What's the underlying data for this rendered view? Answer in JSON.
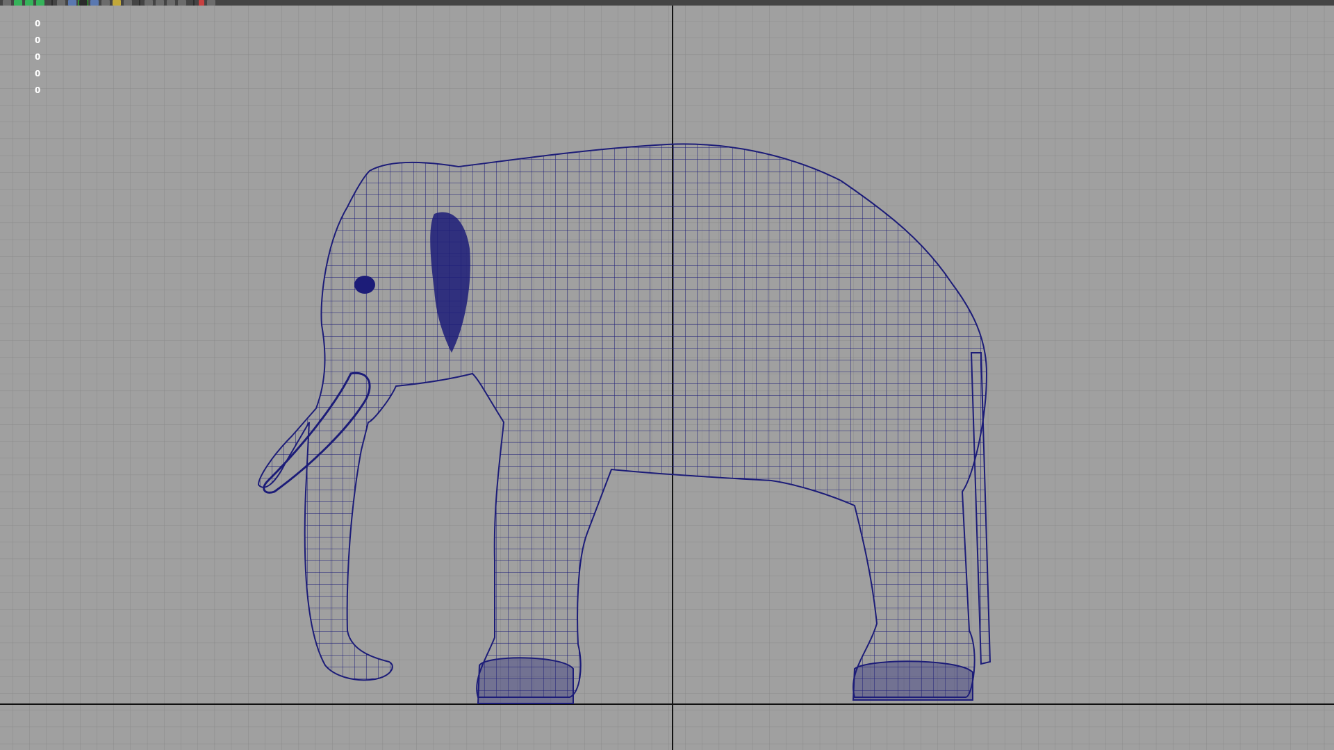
{
  "toolbar": {
    "icons": [
      "select-tool-icon",
      "lasso-tool-icon",
      "paint-tool-icon",
      "move-tool-icon",
      "sphere-icon",
      "camera-icon",
      "selection-mask-icon",
      "globe-icon",
      "render-icon",
      "light-icon",
      "shading-icon",
      "grid-toggle-icon",
      "xray-icon",
      "isolate-icon",
      "snap-icon",
      "frame-icon",
      "display-icon"
    ]
  },
  "hud": {
    "counters": [
      "0",
      "0",
      "0",
      "0",
      "0"
    ]
  },
  "viewport": {
    "background": "#a0a0a0",
    "grid_color": "#8a8a8a",
    "axis_color": "#111111",
    "wire_color": "#1c1c78"
  }
}
